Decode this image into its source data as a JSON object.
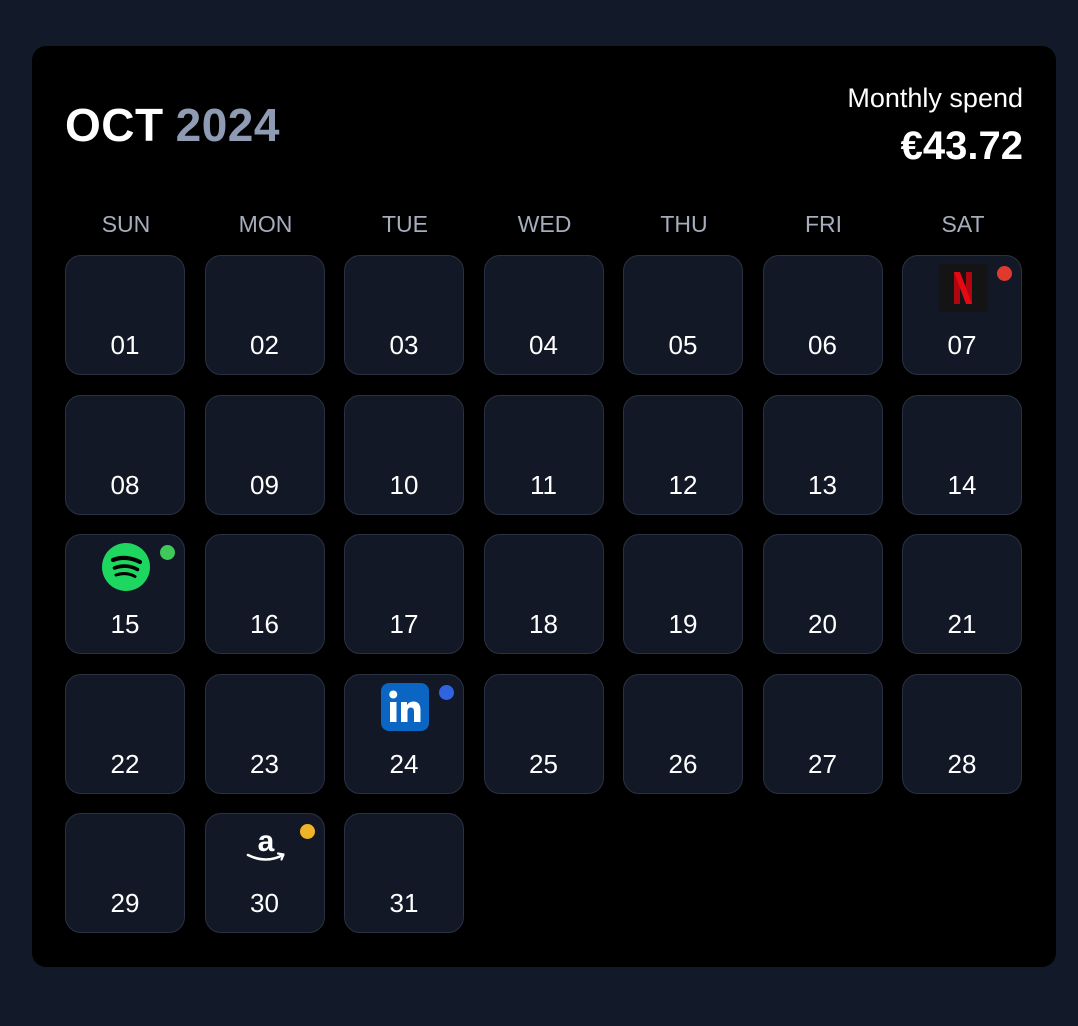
{
  "header": {
    "month": "OCT",
    "year": "2024",
    "spend_label": "Monthly spend",
    "spend_amount": "€43.72"
  },
  "weekdays": [
    "SUN",
    "MON",
    "TUE",
    "WED",
    "THU",
    "FRI",
    "SAT"
  ],
  "days": [
    {
      "label": "01"
    },
    {
      "label": "02"
    },
    {
      "label": "03"
    },
    {
      "label": "04"
    },
    {
      "label": "05"
    },
    {
      "label": "06"
    },
    {
      "label": "07",
      "service": "netflix",
      "icon": "netflix-icon",
      "dot_color": "#e03a2f"
    },
    {
      "label": "08"
    },
    {
      "label": "09"
    },
    {
      "label": "10"
    },
    {
      "label": "11"
    },
    {
      "label": "12"
    },
    {
      "label": "13"
    },
    {
      "label": "14"
    },
    {
      "label": "15",
      "service": "spotify",
      "icon": "spotify-icon",
      "dot_color": "#3ec95a"
    },
    {
      "label": "16"
    },
    {
      "label": "17"
    },
    {
      "label": "18"
    },
    {
      "label": "19"
    },
    {
      "label": "20"
    },
    {
      "label": "21"
    },
    {
      "label": "22"
    },
    {
      "label": "23"
    },
    {
      "label": "24",
      "service": "linkedin",
      "icon": "linkedin-icon",
      "dot_color": "#2f63e0"
    },
    {
      "label": "25"
    },
    {
      "label": "26"
    },
    {
      "label": "27"
    },
    {
      "label": "28"
    },
    {
      "label": "29"
    },
    {
      "label": "30",
      "service": "amazon",
      "icon": "amazon-icon",
      "dot_color": "#f0b429"
    },
    {
      "label": "31"
    }
  ],
  "colors": {
    "page_background": "#121a2a",
    "card_background": "#000000",
    "day_background": "#121826",
    "day_border": "#2a3142",
    "year_text": "#8f9bb3",
    "weekday_text": "#a6adbb"
  }
}
